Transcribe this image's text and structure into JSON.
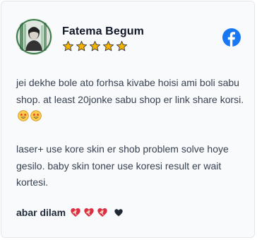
{
  "review": {
    "reviewer_name": "Fatema Begum",
    "rating": 5,
    "source_icon": "facebook-icon",
    "text_paragraph_1": "jei dekhe bole ato forhsa kivabe hoisi ami boli sabu shop. at least 20jonke sabu shop er link share korsi.",
    "text_paragraph_1_emojis": [
      "star-struck-emoji",
      "star-struck-emoji"
    ],
    "text_paragraph_2": "laser+ use kore skin er shob problem solve hoye gesilo. baby skin toner use koresi result er wait kortesi.",
    "footer_text": "abar dilam",
    "footer_emojis": [
      "mending-heart-emoji",
      "mending-heart-emoji",
      "mending-heart-emoji",
      "black-heart-emoji"
    ]
  },
  "colors": {
    "star": "#f5b301",
    "facebook": "#1877f2",
    "card_background": "#f9fafb",
    "card_border": "#e5e7eb"
  }
}
